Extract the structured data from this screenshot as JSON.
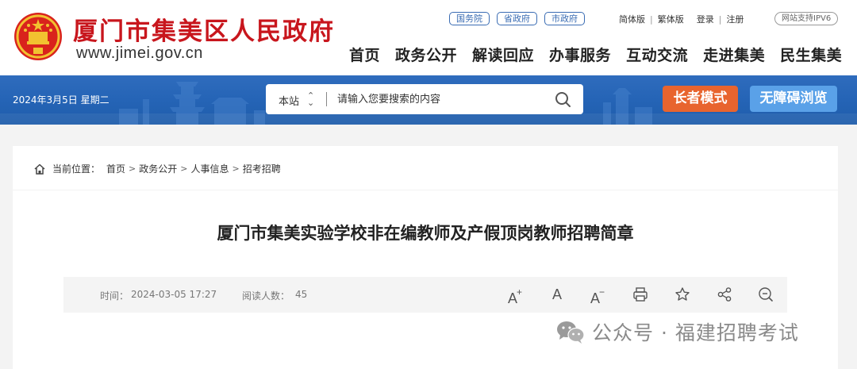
{
  "header": {
    "site_title": "厦门市集美区人民政府",
    "site_url": "www.jimei.gov.cn",
    "gov_links": [
      "国务院",
      "省政府",
      "市政府"
    ],
    "utility": {
      "simplified": "简体版",
      "traditional": "繁体版",
      "login": "登录",
      "register": "注册"
    },
    "ipv6_badge": "网站支持IPV6",
    "nav": [
      "首页",
      "政务公开",
      "解读回应",
      "办事服务",
      "互动交流",
      "走进集美",
      "民生集美"
    ]
  },
  "banner": {
    "date": "2024年3月5日 星期二",
    "search": {
      "scope": "本站",
      "placeholder": "请输入您要搜索的内容"
    },
    "elder_mode": "长者模式",
    "accessibility": "无障碍浏览"
  },
  "breadcrumb": {
    "label": "当前位置：",
    "items": [
      "首页",
      "政务公开",
      "人事信息",
      "招考招聘"
    ]
  },
  "article": {
    "title": "厦门市集美实验学校非在编教师及产假顶岗教师招聘简章",
    "time_label": "时间：",
    "time": "2024-03-05 17:27",
    "views_label": "阅读人数：",
    "views": "45",
    "tools": {
      "font_large": "A",
      "font_normal": "A",
      "font_small": "A"
    }
  },
  "watermark": {
    "text": "公众号 · 福建招聘考试"
  },
  "colors": {
    "brand_red": "#c8161d",
    "banner_blue": "#2564b6",
    "elder_orange": "#e8642e",
    "access_blue": "#5aa1e8"
  }
}
